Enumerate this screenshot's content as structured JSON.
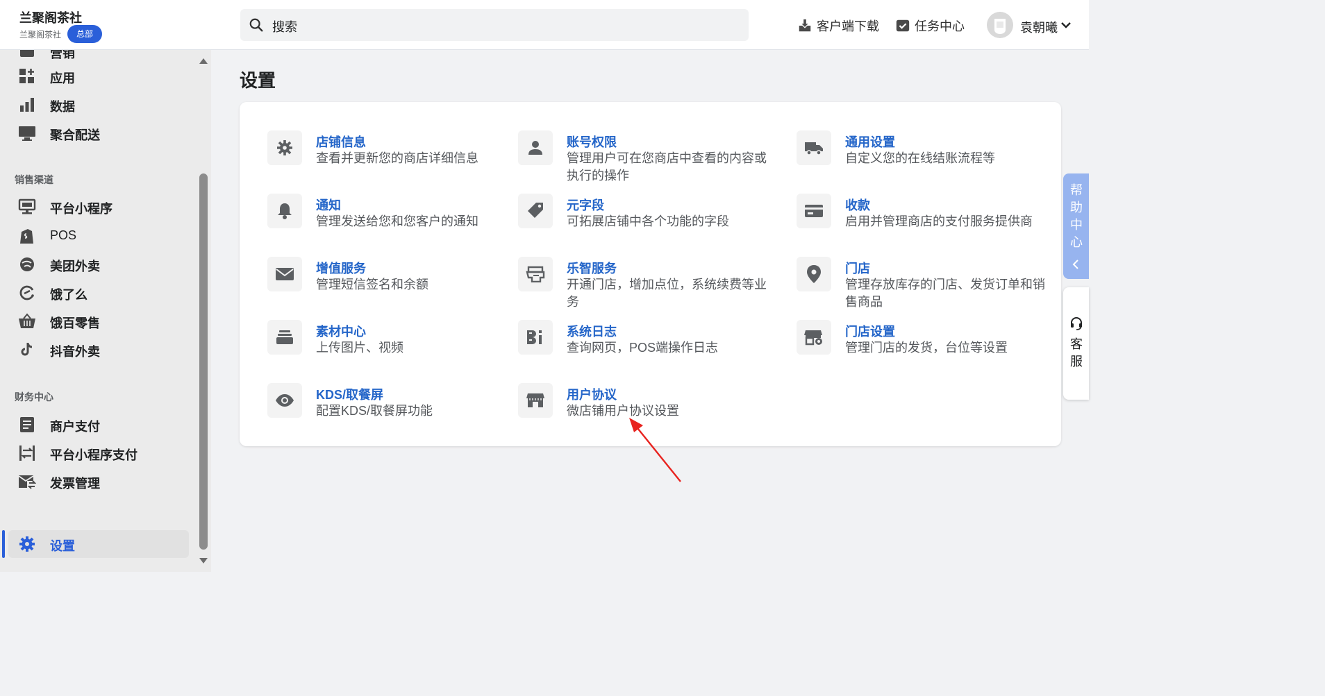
{
  "header": {
    "shop_name": "兰聚阁茶社",
    "shop_sub": "兰聚阁茶社",
    "shop_badge": "总部",
    "search_placeholder": "搜索",
    "download_label": "客户端下载",
    "tasks_label": "任务中心",
    "user_name": "袁朝曦"
  },
  "sidebar": {
    "top_partial": "营销",
    "group1": [
      {
        "label": "应用",
        "icon": "apps-icon"
      },
      {
        "label": "数据",
        "icon": "bar-chart-icon"
      },
      {
        "label": "聚合配送",
        "icon": "monitor-icon"
      }
    ],
    "section_sales": "销售渠道",
    "sales": [
      {
        "label": "平台小程序",
        "icon": "mini-program-icon"
      },
      {
        "label": "POS",
        "icon": "shopping-bag-icon"
      },
      {
        "label": "美团外卖",
        "icon": "meituan-icon"
      },
      {
        "label": "饿了么",
        "icon": "eleme-icon"
      },
      {
        "label": "饿百零售",
        "icon": "basket-icon"
      },
      {
        "label": "抖音外卖",
        "icon": "tiktok-icon"
      }
    ],
    "section_finance": "财务中心",
    "finance": [
      {
        "label": "商户支付",
        "icon": "document-icon"
      },
      {
        "label": "平台小程序支付",
        "icon": "transfer-icon"
      },
      {
        "label": "发票管理",
        "icon": "invoice-mail-icon"
      }
    ],
    "settings_label": "设置"
  },
  "main": {
    "page_title": "设置",
    "settings": [
      {
        "title": "店铺信息",
        "desc": "查看并更新您的商店详细信息",
        "icon": "gear-icon"
      },
      {
        "title": "账号权限",
        "desc": "管理用户可在您商店中查看的内容或执行的操作",
        "icon": "user-icon"
      },
      {
        "title": "通用设置",
        "desc": "自定义您的在线结账流程等",
        "icon": "truck-icon"
      },
      {
        "title": "通知",
        "desc": "管理发送给您和您客户的通知",
        "icon": "bell-icon"
      },
      {
        "title": "元字段",
        "desc": "可拓展店铺中各个功能的字段",
        "icon": "tag-icon"
      },
      {
        "title": "收款",
        "desc": "启用并管理商店的支付服务提供商",
        "icon": "credit-card-icon"
      },
      {
        "title": "增值服务",
        "desc": "管理短信签名和余额",
        "icon": "mail-icon"
      },
      {
        "title": "乐智服务",
        "desc": "开通门店，增加点位，系统续费等业务",
        "icon": "print-icon"
      },
      {
        "title": "门店",
        "desc": "管理存放库存的门店、发货订单和销售商品",
        "icon": "location-pin-icon"
      },
      {
        "title": "素材中心",
        "desc": "上传图片、视频",
        "icon": "stack-icon"
      },
      {
        "title": "系统日志",
        "desc": "查询网页，POS端操作日志",
        "icon": "log-icon"
      },
      {
        "title": "门店设置",
        "desc": "管理门店的发货，台位等设置",
        "icon": "store-settings-icon"
      },
      {
        "title": "KDS/取餐屏",
        "desc": "配置KDS/取餐屏功能",
        "icon": "eye-icon"
      },
      {
        "title": "用户协议",
        "desc": "微店铺用户协议设置",
        "icon": "storefront-icon"
      }
    ]
  },
  "floaters": {
    "help_label": "帮助中心",
    "service_label": "客服"
  },
  "colors": {
    "accent": "#2a5fd9",
    "link": "#2566c9",
    "annotation_arrow": "#e8231f"
  }
}
